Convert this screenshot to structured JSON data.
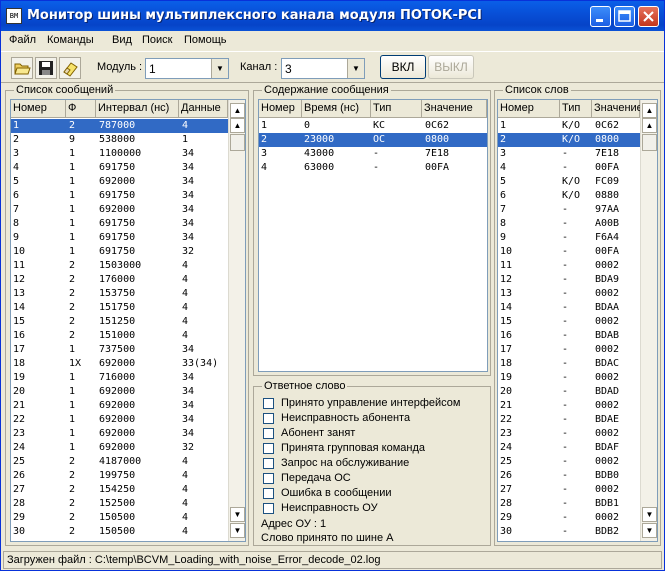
{
  "window": {
    "title": "Монитор шины мультиплексного канала модуля ПОТОК-PCI",
    "icon_text": "BM"
  },
  "menu": [
    "Файл",
    "Команды",
    "Вид",
    "Поиск",
    "Помощь"
  ],
  "toolbar": {
    "module_label": "Модуль :",
    "module_value": "1",
    "channel_label": "Канал :",
    "channel_value": "3",
    "on_label": "ВКЛ",
    "off_label": "ВЫКЛ"
  },
  "messages": {
    "title": "Список сообщений",
    "headers": [
      "Номер",
      "Ф",
      "Интервал (нс)",
      "Данные"
    ],
    "rows": [
      [
        "1",
        "2",
        "787000",
        "4"
      ],
      [
        "2",
        "9",
        "538000",
        "1"
      ],
      [
        "3",
        "1",
        "1100000",
        "34"
      ],
      [
        "4",
        "1",
        "691750",
        "34"
      ],
      [
        "5",
        "1",
        "692000",
        "34"
      ],
      [
        "6",
        "1",
        "691750",
        "34"
      ],
      [
        "7",
        "1",
        "692000",
        "34"
      ],
      [
        "8",
        "1",
        "691750",
        "34"
      ],
      [
        "9",
        "1",
        "691750",
        "34"
      ],
      [
        "10",
        "1",
        "691750",
        "32"
      ],
      [
        "11",
        "2",
        "1503000",
        "4"
      ],
      [
        "12",
        "2",
        "176000",
        "4"
      ],
      [
        "13",
        "2",
        "153750",
        "4"
      ],
      [
        "14",
        "2",
        "151750",
        "4"
      ],
      [
        "15",
        "2",
        "151250",
        "4"
      ],
      [
        "16",
        "2",
        "151000",
        "4"
      ],
      [
        "17",
        "1",
        "737500",
        "34"
      ],
      [
        "18",
        "1X",
        "692000",
        "33(34)"
      ],
      [
        "19",
        "1",
        "716000",
        "34"
      ],
      [
        "20",
        "1",
        "692000",
        "34"
      ],
      [
        "21",
        "1",
        "692000",
        "34"
      ],
      [
        "22",
        "1",
        "692000",
        "34"
      ],
      [
        "23",
        "1",
        "692000",
        "34"
      ],
      [
        "24",
        "1",
        "692000",
        "32"
      ],
      [
        "25",
        "2",
        "4187000",
        "4"
      ],
      [
        "26",
        "2",
        "199750",
        "4"
      ],
      [
        "27",
        "2",
        "154250",
        "4"
      ],
      [
        "28",
        "2",
        "152500",
        "4"
      ],
      [
        "29",
        "2",
        "150500",
        "4"
      ],
      [
        "30",
        "2",
        "150500",
        "4"
      ]
    ]
  },
  "content": {
    "title": "Содержание сообщения",
    "headers": [
      "Номер",
      "Время (нс)",
      "Тип",
      "Значение"
    ],
    "rows": [
      [
        "1",
        "0",
        "КС",
        "0C62"
      ],
      [
        "2",
        "23000",
        "ОС",
        "0800"
      ],
      [
        "3",
        "43000",
        "-",
        "7E18"
      ],
      [
        "4",
        "63000",
        "-",
        "00FA"
      ]
    ]
  },
  "response": {
    "title": "Ответное слово",
    "items": [
      "Принято управление интерфейсом",
      "Неисправность абонента",
      "Абонент занят",
      "Принята групповая команда",
      "Запрос на обслуживание",
      "Передача ОС",
      "Ошибка в сообщении",
      "Неисправность ОУ"
    ],
    "address": "Адрес ОУ : 1",
    "bus": "Слово принято по шине А"
  },
  "words": {
    "title": "Список слов",
    "headers": [
      "Номер",
      "Тип",
      "Значение"
    ],
    "rows": [
      [
        "1",
        "К/О",
        "0C62"
      ],
      [
        "2",
        "К/О",
        "0800"
      ],
      [
        "3",
        "-",
        "7E18"
      ],
      [
        "4",
        "-",
        "00FA"
      ],
      [
        "5",
        "К/О",
        "FC09"
      ],
      [
        "6",
        "К/О",
        "0880"
      ],
      [
        "7",
        "-",
        "97AA"
      ],
      [
        "8",
        "-",
        "A00B"
      ],
      [
        "9",
        "-",
        "F6A4"
      ],
      [
        "10",
        "-",
        "00FA"
      ],
      [
        "11",
        "-",
        "0002"
      ],
      [
        "12",
        "-",
        "BDA9"
      ],
      [
        "13",
        "-",
        "0002"
      ],
      [
        "14",
        "-",
        "BDAA"
      ],
      [
        "15",
        "-",
        "0002"
      ],
      [
        "16",
        "-",
        "BDAB"
      ],
      [
        "17",
        "-",
        "0002"
      ],
      [
        "18",
        "-",
        "BDAC"
      ],
      [
        "19",
        "-",
        "0002"
      ],
      [
        "20",
        "-",
        "BDAD"
      ],
      [
        "21",
        "-",
        "0002"
      ],
      [
        "22",
        "-",
        "BDAE"
      ],
      [
        "23",
        "-",
        "0002"
      ],
      [
        "24",
        "-",
        "BDAF"
      ],
      [
        "25",
        "-",
        "0002"
      ],
      [
        "26",
        "-",
        "BDB0"
      ],
      [
        "27",
        "-",
        "0002"
      ],
      [
        "28",
        "-",
        "BDB1"
      ],
      [
        "29",
        "-",
        "0002"
      ],
      [
        "30",
        "-",
        "BDB2"
      ]
    ]
  },
  "status_bar": "Загружен файл : C:\\temp\\BCVM_Loading_with_noise_Error_decode_02.log"
}
